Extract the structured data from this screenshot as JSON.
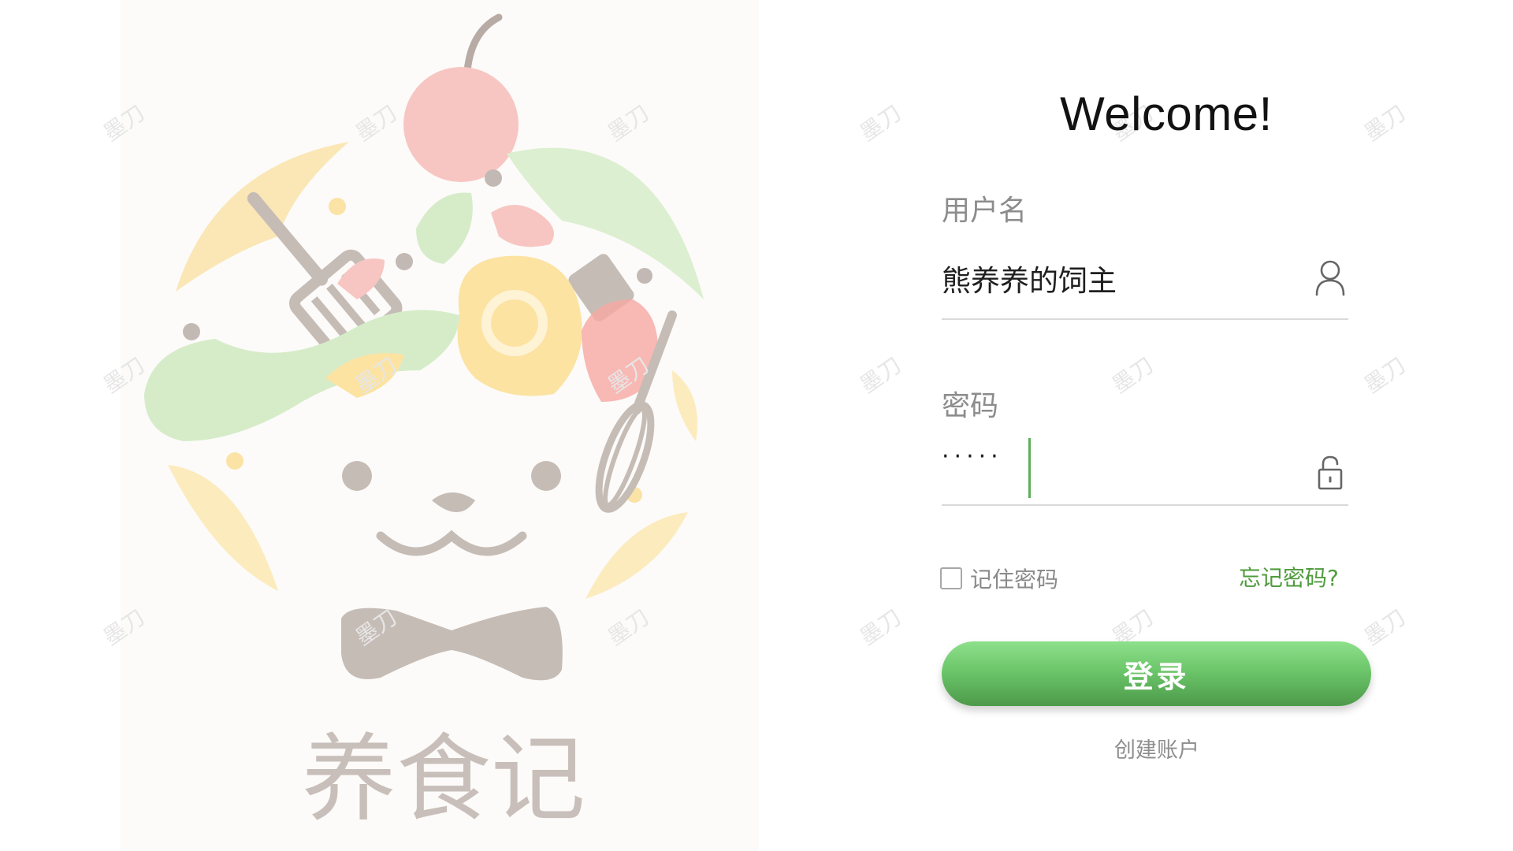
{
  "illustration": {
    "brand_text": "养食记",
    "alt_name": "cooking-bear-logo"
  },
  "watermark": {
    "text": "墨刀"
  },
  "login": {
    "welcome_title": "Welcome!",
    "username_label": "用户名",
    "username_value": "熊养养的饲主",
    "password_label": "密码",
    "password_value": "·····",
    "remember_label": "记住密码",
    "remember_checked": false,
    "forgot_label": "忘记密码?",
    "submit_label": "登录",
    "create_account_label": "创建账户"
  },
  "icons": {
    "username_icon": "user-icon",
    "password_icon": "unlock-icon"
  },
  "colors": {
    "accent_green": "#5cae58",
    "link_green": "#4f9b3d",
    "button_top": "#8ee08b",
    "button_bottom": "#4d9a4a",
    "label_gray": "#8c8c8c"
  }
}
